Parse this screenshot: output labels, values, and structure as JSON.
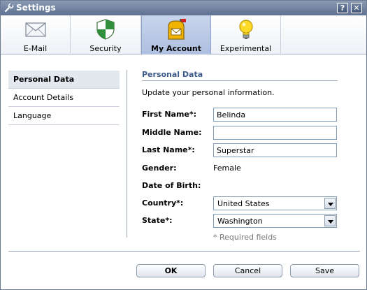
{
  "window": {
    "title": "Settings",
    "help_label": "?",
    "close_label": "✕"
  },
  "tabs": [
    {
      "label": "E-Mail",
      "icon": "envelope-icon"
    },
    {
      "label": "Security",
      "icon": "shield-icon"
    },
    {
      "label": "My Account",
      "icon": "mailbox-icon",
      "active": true
    },
    {
      "label": "Experimental",
      "icon": "lightbulb-icon"
    }
  ],
  "sidebar": {
    "items": [
      {
        "label": "Personal Data",
        "active": true
      },
      {
        "label": "Account Details"
      },
      {
        "label": "Language"
      }
    ]
  },
  "content": {
    "section_title": "Personal Data",
    "intro": "Update your personal information.",
    "fields": {
      "first_name": {
        "label": "First Name*:",
        "value": "Belinda"
      },
      "middle_name": {
        "label": "Middle Name:",
        "value": ""
      },
      "last_name": {
        "label": "Last Name*:",
        "value": "Superstar"
      },
      "gender": {
        "label": "Gender:",
        "value": "Female"
      },
      "dob": {
        "label": "Date of Birth:"
      },
      "country": {
        "label": "Country*:",
        "value": "United States"
      },
      "state": {
        "label": "State*:",
        "value": "Washington"
      }
    },
    "required_note": "* Required fields"
  },
  "footer": {
    "ok_label": "OK",
    "cancel_label": "Cancel",
    "save_label": "Save"
  },
  "colors": {
    "titlebar": "#5e7191",
    "section_title": "#3d5b8a",
    "active_tab": "#aebfe0"
  }
}
